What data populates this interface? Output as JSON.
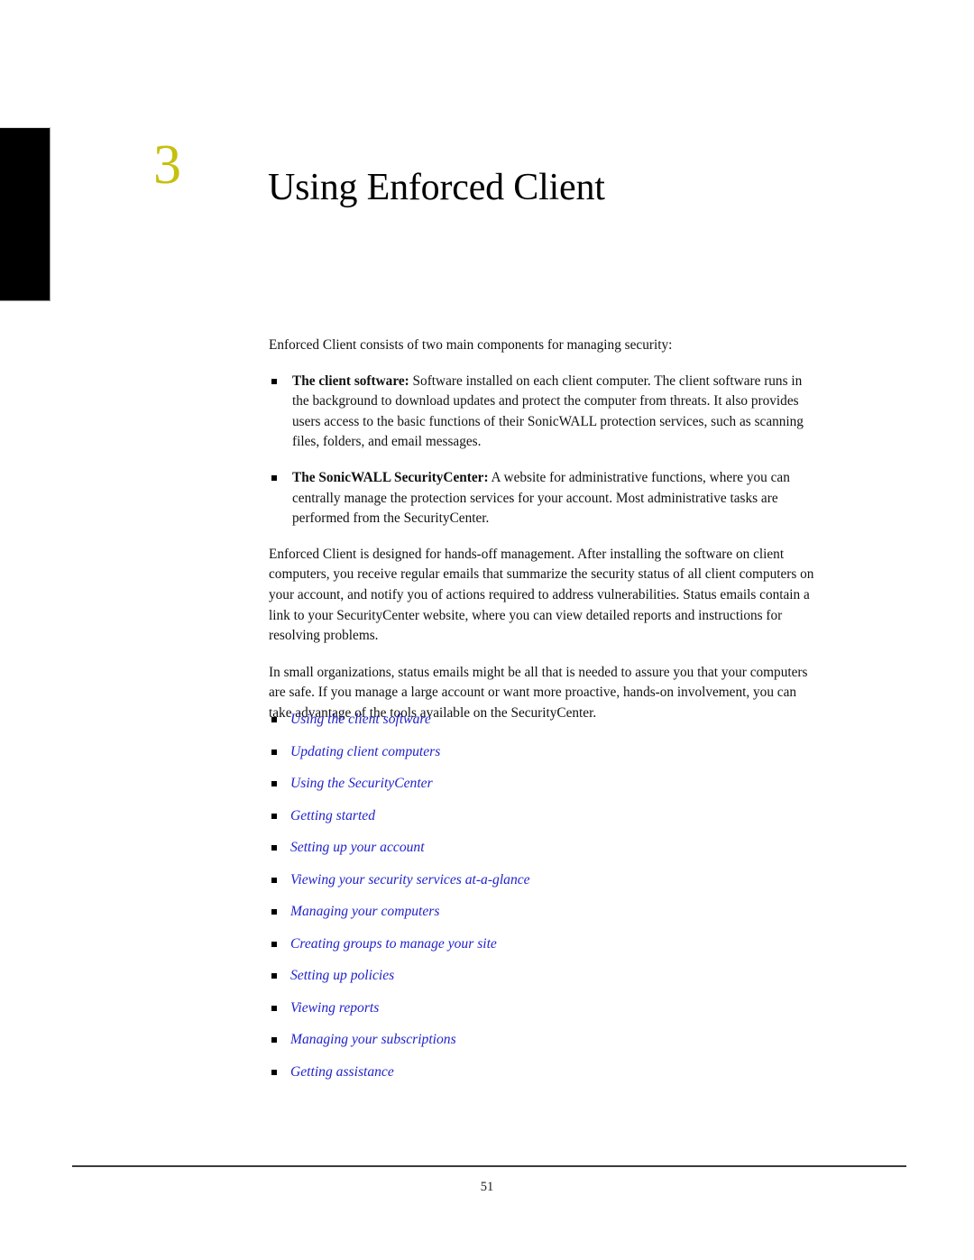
{
  "chapter": {
    "number": "3",
    "title": "Using Enforced Client",
    "number_color": "#c6c00f"
  },
  "intro": {
    "lead": "Enforced Client consists of two main components for managing security:"
  },
  "components": [
    {
      "term": "The client software:",
      "text": " Software installed on each client computer. The client software runs in the background to download updates and protect the computer from threats. It also provides users access to the basic functions of their SonicWALL protection services, such as scanning files, folders, and email messages."
    },
    {
      "term": "The SonicWALL SecurityCenter:",
      "text": " A website for administrative functions, where you can centrally manage the protection services for your account. Most administrative tasks are performed from the SecurityCenter."
    }
  ],
  "paragraphs": [
    "Enforced Client is designed for hands-off management. After installing the software on client computers, you receive regular emails that summarize the security status of all client computers on your account, and notify you of actions required to address vulnerabilities. Status emails contain a link to your SecurityCenter website, where you can view detailed reports and instructions for resolving problems.",
    "In small organizations, status emails might be all that is needed to assure you that your computers are safe. If you manage a large account or want more proactive, hands-on involvement, you can take advantage of the tools available on the SecurityCenter."
  ],
  "links": {
    "color": "#2222cc",
    "items": [
      {
        "label": "Using the client software"
      },
      {
        "label": "Updating client computers"
      },
      {
        "label": "Using the SecurityCenter"
      },
      {
        "label": "Getting started"
      },
      {
        "label": "Setting up your account"
      },
      {
        "label": "Viewing your security services at-a-glance"
      },
      {
        "label": "Managing your computers"
      },
      {
        "label": "Creating groups to manage your site"
      },
      {
        "label": "Setting up policies"
      },
      {
        "label": "Viewing reports"
      },
      {
        "label": "Managing your subscriptions"
      },
      {
        "label": "Getting assistance"
      }
    ]
  },
  "footer": {
    "page_number": "51"
  }
}
